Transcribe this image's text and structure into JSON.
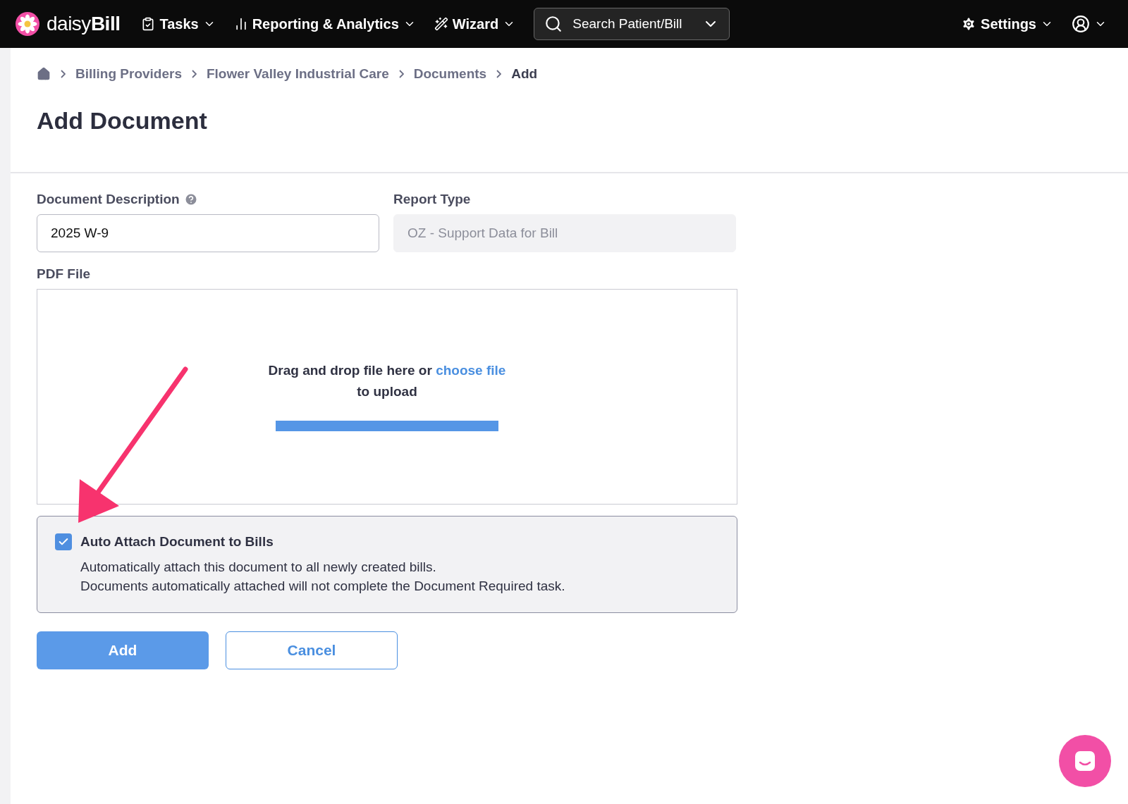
{
  "navbar": {
    "logo_prefix": "daisy",
    "logo_suffix": "Bill",
    "menus": [
      {
        "label": "Tasks",
        "kind": "tasks"
      },
      {
        "label": "Reporting & Analytics",
        "kind": "reports"
      },
      {
        "label": "Wizard",
        "kind": "wizard"
      }
    ],
    "search": {
      "placeholder": "Search Patient/Bill"
    },
    "settings": {
      "label": "Settings"
    }
  },
  "breadcrumb": [
    {
      "label": "Billing Providers",
      "current": false
    },
    {
      "label": "Flower Valley Industrial Care",
      "current": false
    },
    {
      "label": "Documents",
      "current": false
    },
    {
      "label": "Add",
      "current": true
    }
  ],
  "page_title": "Add Document",
  "form": {
    "description": {
      "label": "Document Description",
      "value": "2025 W-9"
    },
    "report_type": {
      "label": "Report Type",
      "value": "OZ - Support Data for Bill",
      "disabled": true
    },
    "pdf_file": {
      "label": "PDF File",
      "prompt": "Drag and drop file here or",
      "link": "choose file",
      "suffix": "to upload"
    },
    "auto_attach": {
      "label": "Auto Attach Document to Bills",
      "checked": true,
      "help_lines": [
        "Automatically attach this document to all newly created bills.",
        "Documents automatically attached will not complete the Document Required task."
      ]
    },
    "buttons": [
      {
        "label": "Add",
        "kind": "primary"
      },
      {
        "label": "Cancel",
        "kind": "secondary"
      }
    ]
  }
}
